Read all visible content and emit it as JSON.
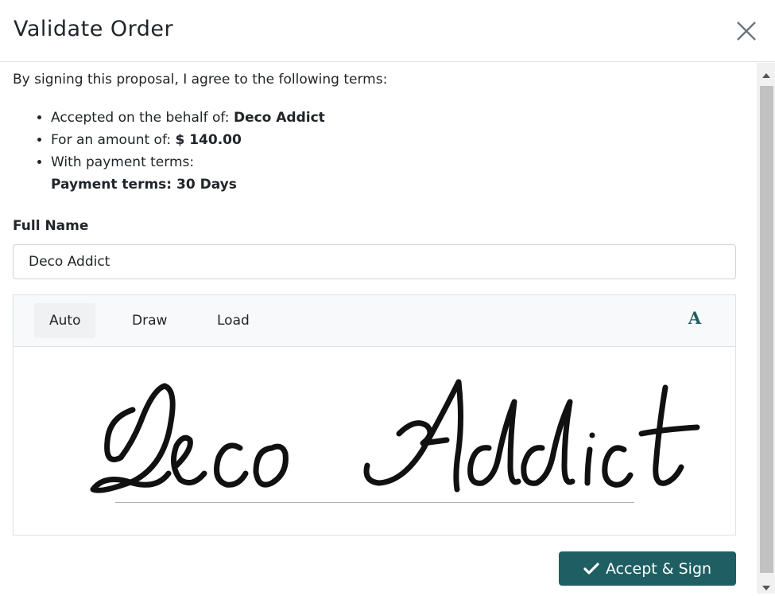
{
  "dialog": {
    "title": "Validate Order",
    "close_icon": "close-icon"
  },
  "terms": {
    "intro": "By signing this proposal, I agree to the following terms:",
    "accepted_label": "Accepted on the behalf of: ",
    "accepted_value": "Deco Addict",
    "amount_label": "For an amount of: ",
    "amount_value": "$ 140.00",
    "payment_label": "With payment terms:",
    "payment_value": "Payment terms: 30 Days"
  },
  "form": {
    "full_name_label": "Full Name",
    "full_name_value": "Deco Addict"
  },
  "signature": {
    "tabs": [
      "Auto",
      "Draw",
      "Load"
    ],
    "active_tab": "Auto",
    "font_button": "A",
    "font_icon": "font-style-icon",
    "signature_text": "Deco Addict"
  },
  "footer": {
    "accept_label": "Accept & Sign",
    "accept_icon": "check-icon"
  },
  "colors": {
    "primary": "#1f5f63"
  }
}
